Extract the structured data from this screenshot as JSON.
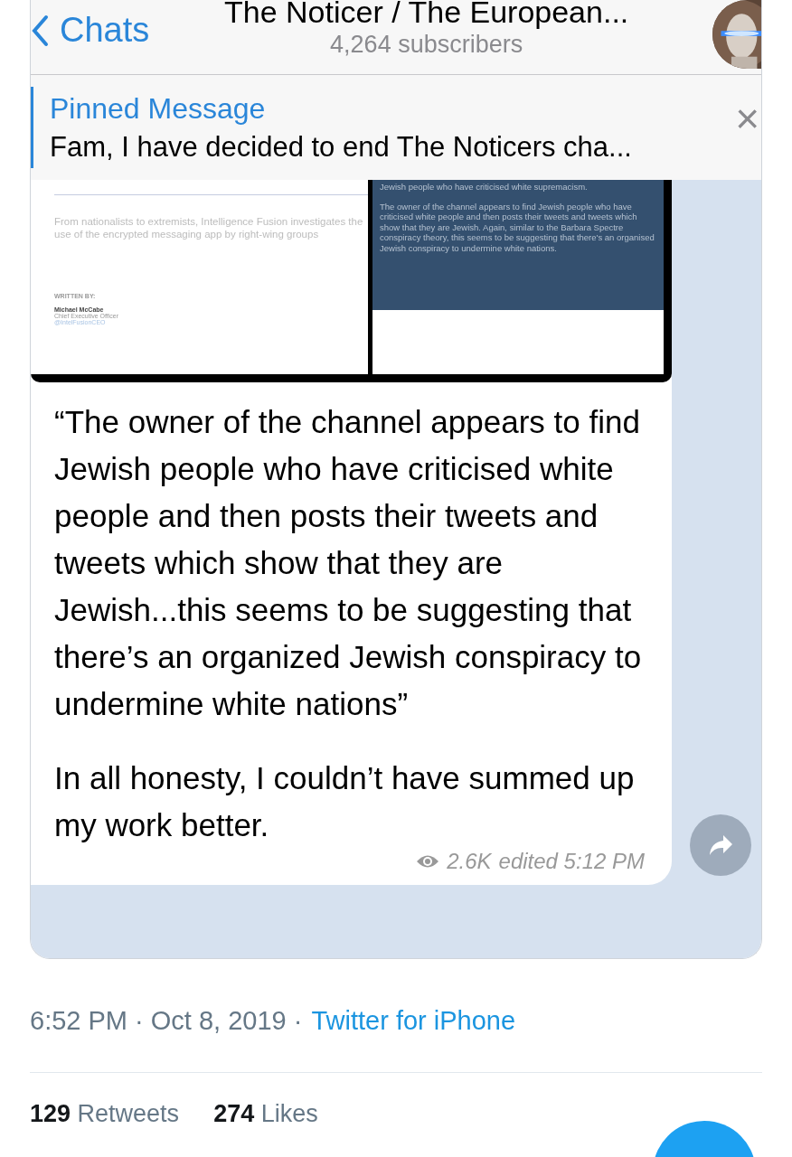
{
  "chat_header": {
    "back_label": "Chats",
    "title": "The Noticer / The European...",
    "subtitle": "4,264 subscribers"
  },
  "pinned": {
    "label": "Pinned Message",
    "text": "Fam, I have decided to end The Noticers cha...",
    "close": "×"
  },
  "message": {
    "image": {
      "left": {
        "summary": "From nationalists to extremists, Intelligence Fusion investigates the use of the encrypted messaging app by right-wing groups",
        "byline_label": "WRITTEN BY:",
        "author": "Michael McCabe",
        "role": "Chief Executive Officer",
        "handle": "@IntelFusionCEO"
      },
      "right": {
        "lines": [
          "Jewish people who have criticised white supremacism.",
          "The owner of the channel appears to find Jewish people who have criticised white people and then posts their tweets and tweets which show that they are Jewish. Again, similar to the Barbara Spectre conspiracy theory, this seems to be suggesting that there's an organised Jewish conspiracy to undermine white nations."
        ]
      }
    },
    "paragraphs": [
      "“The owner of the channel appears to find Jewish people who have criticised white people and then posts their tweets and tweets which show that they are Jewish...this seems to be suggesting that there’s an organized Jewish conspiracy to undermine white nations”",
      "In all honesty, I couldn’t have summed up my work better."
    ],
    "views": "2.6K",
    "edited": "edited 5:12 PM"
  },
  "tweet_meta": {
    "time": "6:52 PM · Oct 8, 2019 ·",
    "source": "Twitter for iPhone"
  },
  "stats": [
    {
      "count": "129",
      "label": "Retweets"
    },
    {
      "count": "274",
      "label": "Likes"
    }
  ]
}
